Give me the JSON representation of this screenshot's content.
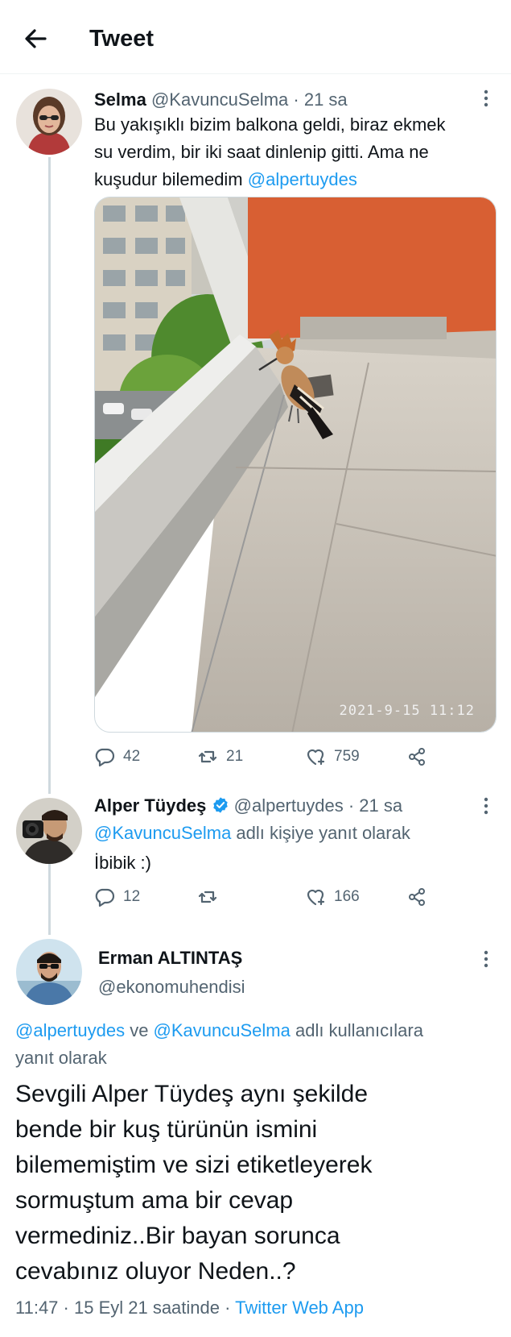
{
  "header": {
    "title": "Tweet"
  },
  "tweet1": {
    "name": "Selma",
    "handle": "@KavuncuSelma",
    "sep": "·",
    "time": "21 sa",
    "text_line1": "Bu yakışıklı bizim balkona geldi, biraz ekmek",
    "text_line2": "su verdim, bir iki saat dinlenip gitti. Ama ne",
    "text_line3": "kuşudur bilemedim",
    "mention": "@alpertuydes",
    "photo_stamp": "2021-9-15 11:12",
    "replies": "42",
    "retweets": "21",
    "likes": "759"
  },
  "tweet2": {
    "name": "Alper Tüydeş",
    "handle": "@alpertuydes",
    "sep": "·",
    "time": "21 sa",
    "reply_to": "@KavuncuSelma",
    "reply_suffix": " adlı kişiye yanıt olarak",
    "text": "İbibik :)",
    "replies": "12",
    "retweets": "",
    "likes": "166"
  },
  "tweet3": {
    "name": "Erman ALTINTAŞ",
    "handle": "@ekonomuhendisi",
    "reply_mention1": "@alpertuydes",
    "reply_and": " ve ",
    "reply_mention2": "@KavuncuSelma",
    "reply_suffix": " adlı kullanıcılara",
    "reply_line2": "yanıt olarak",
    "body": [
      "Sevgili Alper Tüydeş aynı şekilde",
      "bende bir kuş türünün ismini",
      "bilememiştim ve sizi etiketleyerek",
      "sormuştum ama bir cevap",
      "vermediniz..Bir bayan sorunca",
      "cevabınız oluyor Neden..?"
    ],
    "time": "11:47",
    "sep": " · ",
    "date": "15 Eyl 21 saatinde",
    "sep2": " · ",
    "client": "Twitter Web App"
  },
  "colors": {
    "link": "#1d9bf0",
    "muted": "#536471",
    "thread": "#cfd9de"
  },
  "icons": [
    "back-arrow-icon",
    "more-icon",
    "reply-icon",
    "retweet-icon",
    "like-icon",
    "share-icon",
    "verified-icon"
  ]
}
